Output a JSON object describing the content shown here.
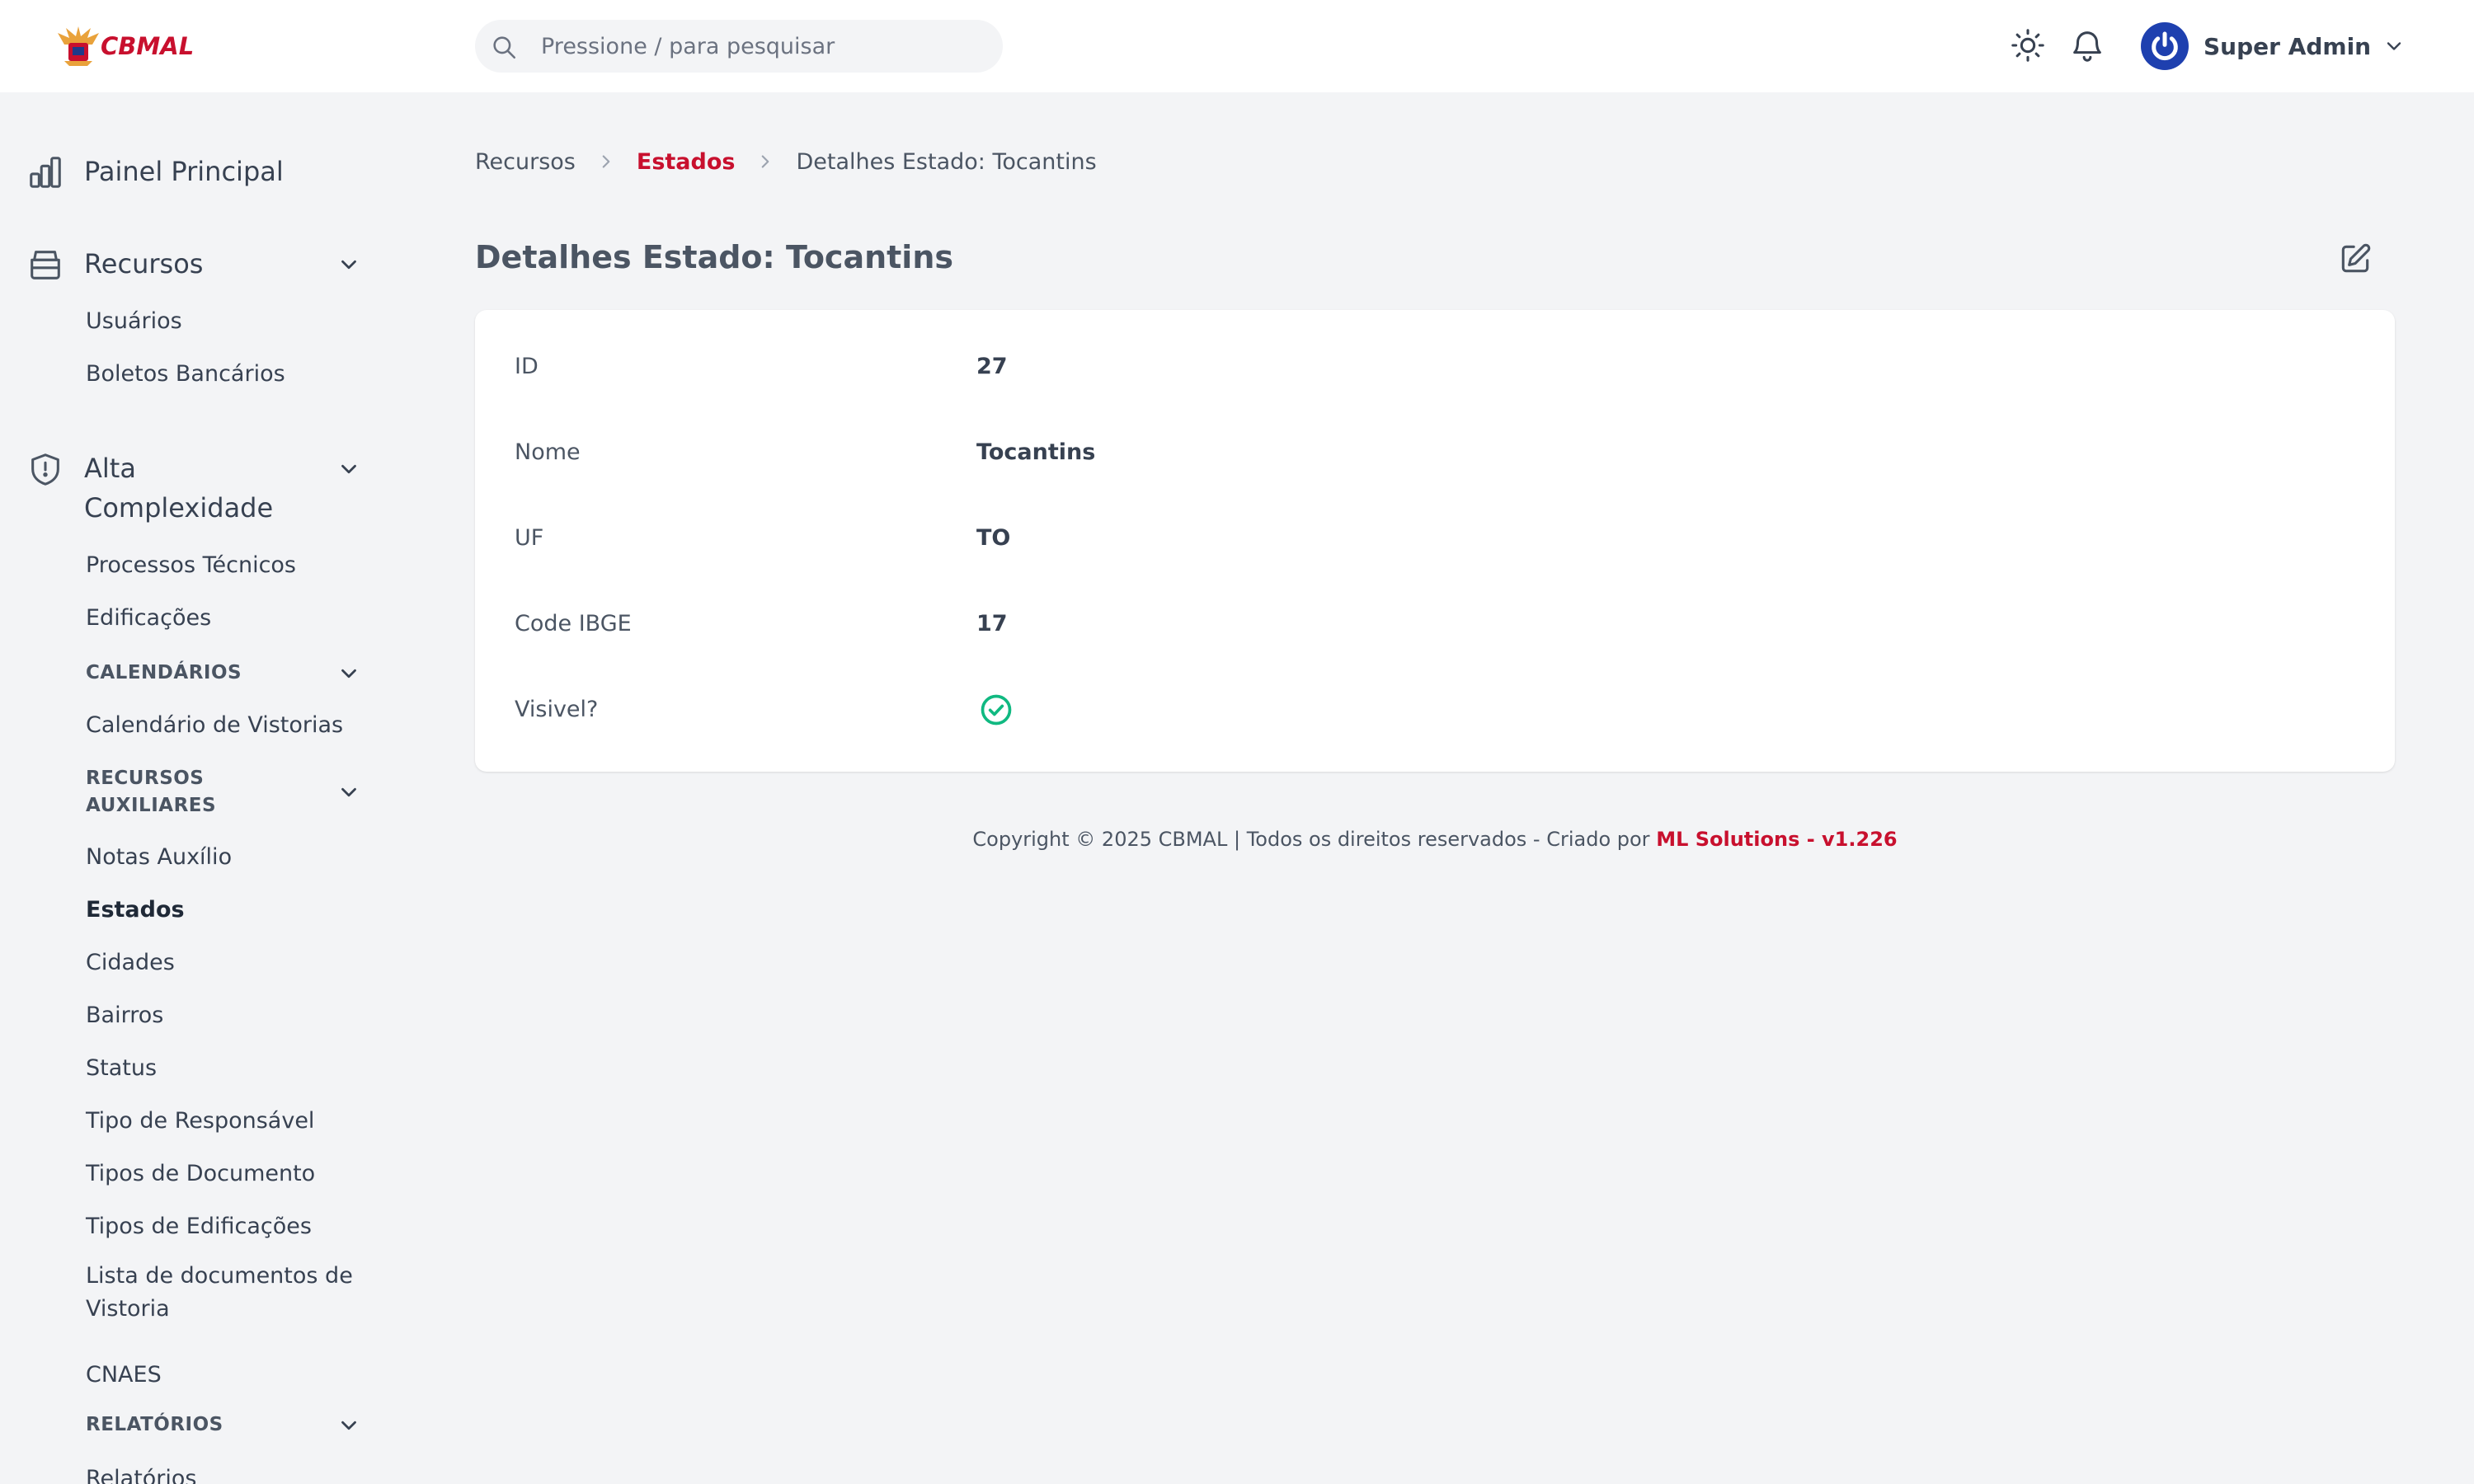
{
  "brand": {
    "logo_text": "CBMAL",
    "accent": "#c8102e"
  },
  "search": {
    "placeholder": "Pressione / para pesquisar"
  },
  "header": {
    "theme_icon": "sun-icon",
    "notification_icon": "bell-icon",
    "user_name": "Super Admin"
  },
  "sidebar": {
    "dashboard": "Painel Principal",
    "resources": {
      "label": "Recursos",
      "items": [
        "Usuários",
        "Boletos Bancários"
      ]
    },
    "high_complexity": {
      "label_line1": "Alta",
      "label_line2": "Complexidade",
      "items": [
        "Processos Técnicos",
        "Edificações"
      ]
    },
    "calendars": {
      "label": "CALENDÁRIOS",
      "items": [
        "Calendário de Vistorias"
      ]
    },
    "aux_resources": {
      "label_line1": "RECURSOS",
      "label_line2": "AUXILIARES",
      "items": [
        "Notas Auxílio",
        "Estados",
        "Cidades",
        "Bairros",
        "Status",
        "Tipo de Responsável",
        "Tipos de Documento",
        "Tipos de Edificações"
      ],
      "docs_line1": "Lista de documentos de",
      "docs_line2": "Vistoria",
      "cnaes": "CNAES"
    },
    "reports": {
      "label": "RELATÓRIOS",
      "items": [
        "Relatórios"
      ]
    }
  },
  "breadcrumb": [
    "Recursos",
    "Estados",
    "Detalhes Estado: Tocantins"
  ],
  "page": {
    "title": "Detalhes Estado: Tocantins"
  },
  "details": [
    {
      "label": "ID",
      "value": "27"
    },
    {
      "label": "Nome",
      "value": "Tocantins"
    },
    {
      "label": "UF",
      "value": "TO"
    },
    {
      "label": "Code IBGE",
      "value": "17"
    },
    {
      "label": "Visivel?",
      "value": true
    }
  ],
  "footer": {
    "text": "Copyright © 2025 CBMAL | Todos os direitos reservados - Criado por ",
    "link": "ML Solutions - v1.226"
  },
  "colors": {
    "success": "#10b981",
    "avatar": "#1e40af"
  }
}
